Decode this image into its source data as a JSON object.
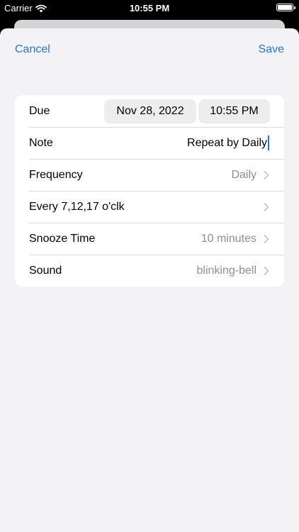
{
  "status_bar": {
    "carrier": "Carrier",
    "time": "10:55 PM",
    "wifi_icon": "wifi-icon",
    "battery_icon": "battery-icon"
  },
  "nav": {
    "cancel_label": "Cancel",
    "save_label": "Save"
  },
  "form": {
    "due": {
      "label": "Due",
      "date": "Nov 28, 2022",
      "time": "10:55 PM"
    },
    "note": {
      "label": "Note",
      "value": "Repeat by Daily"
    },
    "frequency": {
      "label": "Frequency",
      "value": "Daily"
    },
    "every": {
      "label": "Every 7,12,17 o'clk"
    },
    "snooze": {
      "label": "Snooze Time",
      "value": "10 minutes"
    },
    "sound": {
      "label": "Sound",
      "value": "blinking-bell"
    }
  },
  "colors": {
    "accent": "#1a7ad6",
    "background": "#f2f2f7",
    "secondary_text": "#8e8e93"
  }
}
